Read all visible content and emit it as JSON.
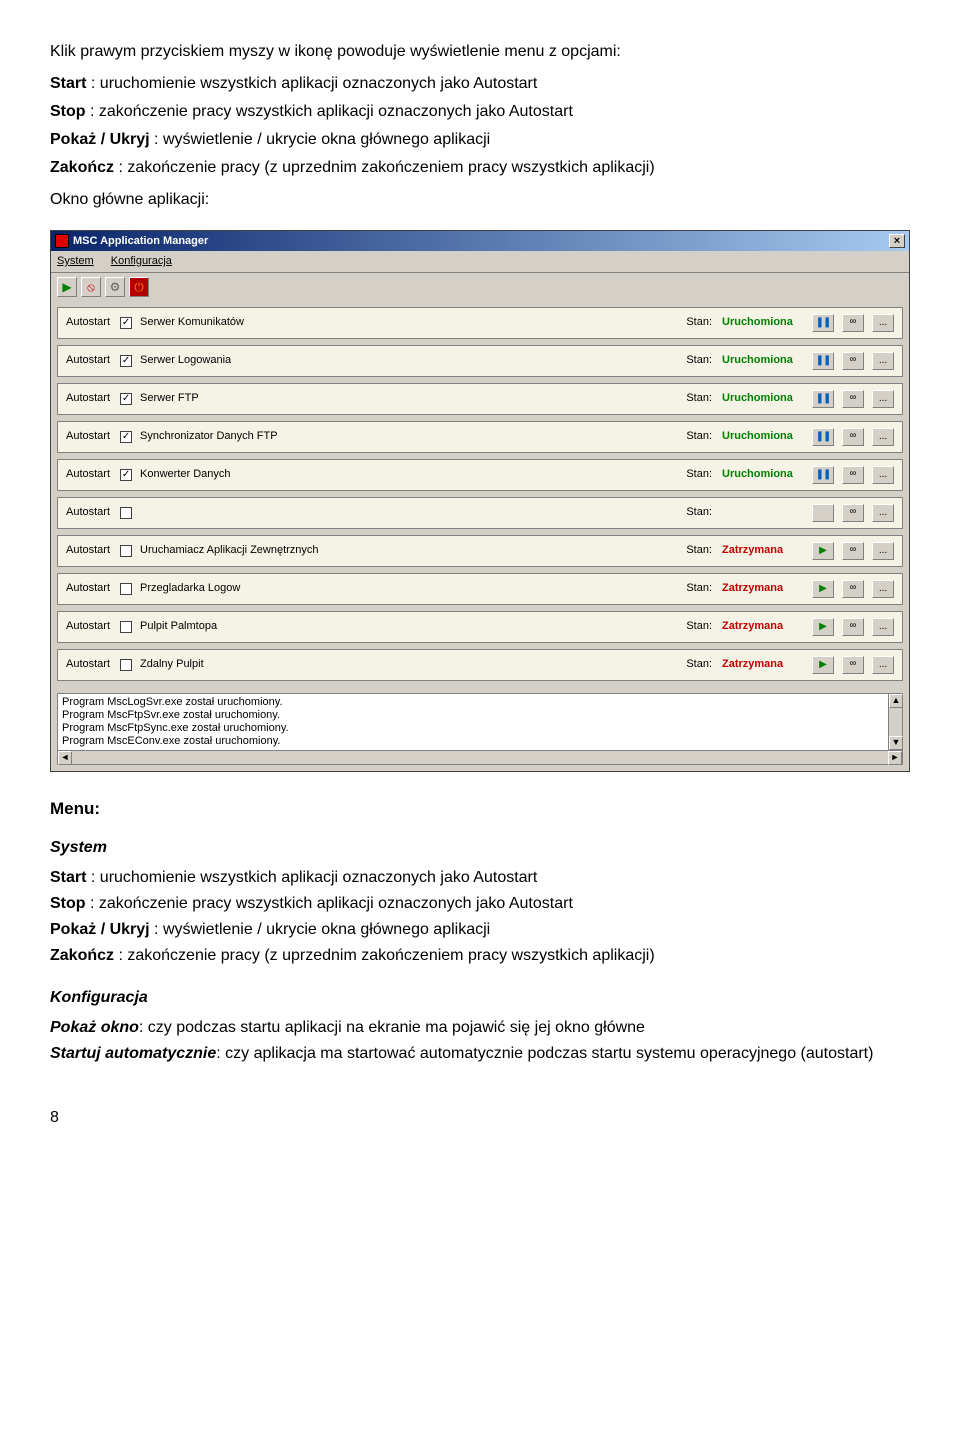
{
  "intro": {
    "lead": "Klik prawym przyciskiem myszy w ikonę powoduje wyświetlenie menu z opcjami:",
    "items": [
      {
        "label": "Start",
        "text": " : uruchomienie wszystkich aplikacji oznaczonych jako Autostart"
      },
      {
        "label": "Stop",
        "text": " : zakończenie pracy wszystkich aplikacji oznaczonych jako Autostart"
      },
      {
        "label": "Pokaż / Ukryj",
        "text": " : wyświetlenie / ukrycie okna głównego aplikacji"
      },
      {
        "label": "Zakończ",
        "text": " : zakończenie pracy (z uprzednim zakończeniem pracy wszystkich aplikacji)"
      }
    ],
    "main_window_label": "Okno główne aplikacji:"
  },
  "app": {
    "title": "MSC Application Manager",
    "menus": [
      "System",
      "Konfiguracja"
    ],
    "toolbar_icons": [
      "▶",
      "⦸",
      "⚙",
      "⏻"
    ],
    "autostart_label": "Autostart",
    "stan_label": "Stan:",
    "dots": "...",
    "link_glyph": "∞",
    "pause_glyph": "❚❚",
    "play_glyph": "▶",
    "rows": [
      {
        "checked": true,
        "name": "Serwer Komunikatów",
        "status": "Uruchomiona",
        "running": true
      },
      {
        "checked": true,
        "name": "Serwer Logowania",
        "status": "Uruchomiona",
        "running": true
      },
      {
        "checked": true,
        "name": "Serwer FTP",
        "status": "Uruchomiona",
        "running": true
      },
      {
        "checked": true,
        "name": "Synchronizator Danych FTP",
        "status": "Uruchomiona",
        "running": true
      },
      {
        "checked": true,
        "name": "Konwerter Danych",
        "status": "Uruchomiona",
        "running": true
      },
      {
        "checked": false,
        "name": "",
        "status": "",
        "running": null
      },
      {
        "checked": false,
        "name": "Uruchamiacz Aplikacji Zewnętrznych",
        "status": "Zatrzymana",
        "running": false
      },
      {
        "checked": false,
        "name": "Przegladarka Logow",
        "status": "Zatrzymana",
        "running": false
      },
      {
        "checked": false,
        "name": "Pulpit Palmtopa",
        "status": "Zatrzymana",
        "running": false
      },
      {
        "checked": false,
        "name": "Zdalny Pulpit",
        "status": "Zatrzymana",
        "running": false
      }
    ],
    "log": [
      "Program MscLogSvr.exe został uruchomiony.",
      "Program MscFtpSvr.exe został uruchomiony.",
      "Program MscFtpSync.exe został uruchomiony.",
      "Program MscEConv.exe został uruchomiony."
    ]
  },
  "menu_section": {
    "heading": "Menu:",
    "system": {
      "title": "System",
      "items": [
        {
          "label": "Start",
          "text": " : uruchomienie wszystkich aplikacji oznaczonych jako Autostart"
        },
        {
          "label": "Stop",
          "text": " : zakończenie pracy wszystkich aplikacji oznaczonych jako Autostart"
        },
        {
          "label": "Pokaż / Ukryj",
          "text": " : wyświetlenie / ukrycie okna głównego aplikacji"
        },
        {
          "label": "Zakończ",
          "text": " : zakończenie pracy (z uprzednim zakończeniem pracy wszystkich aplikacji)"
        }
      ]
    },
    "konfiguracja": {
      "title": "Konfiguracja",
      "items": [
        {
          "label": "Pokaż okno",
          "text": ": czy podczas startu aplikacji na ekranie ma pojawić się jej okno główne"
        },
        {
          "label": "Startuj automatycznie",
          "text": ": czy aplikacja ma startować automatycznie podczas startu systemu operacyjnego (autostart)"
        }
      ]
    }
  },
  "page_number": "8"
}
